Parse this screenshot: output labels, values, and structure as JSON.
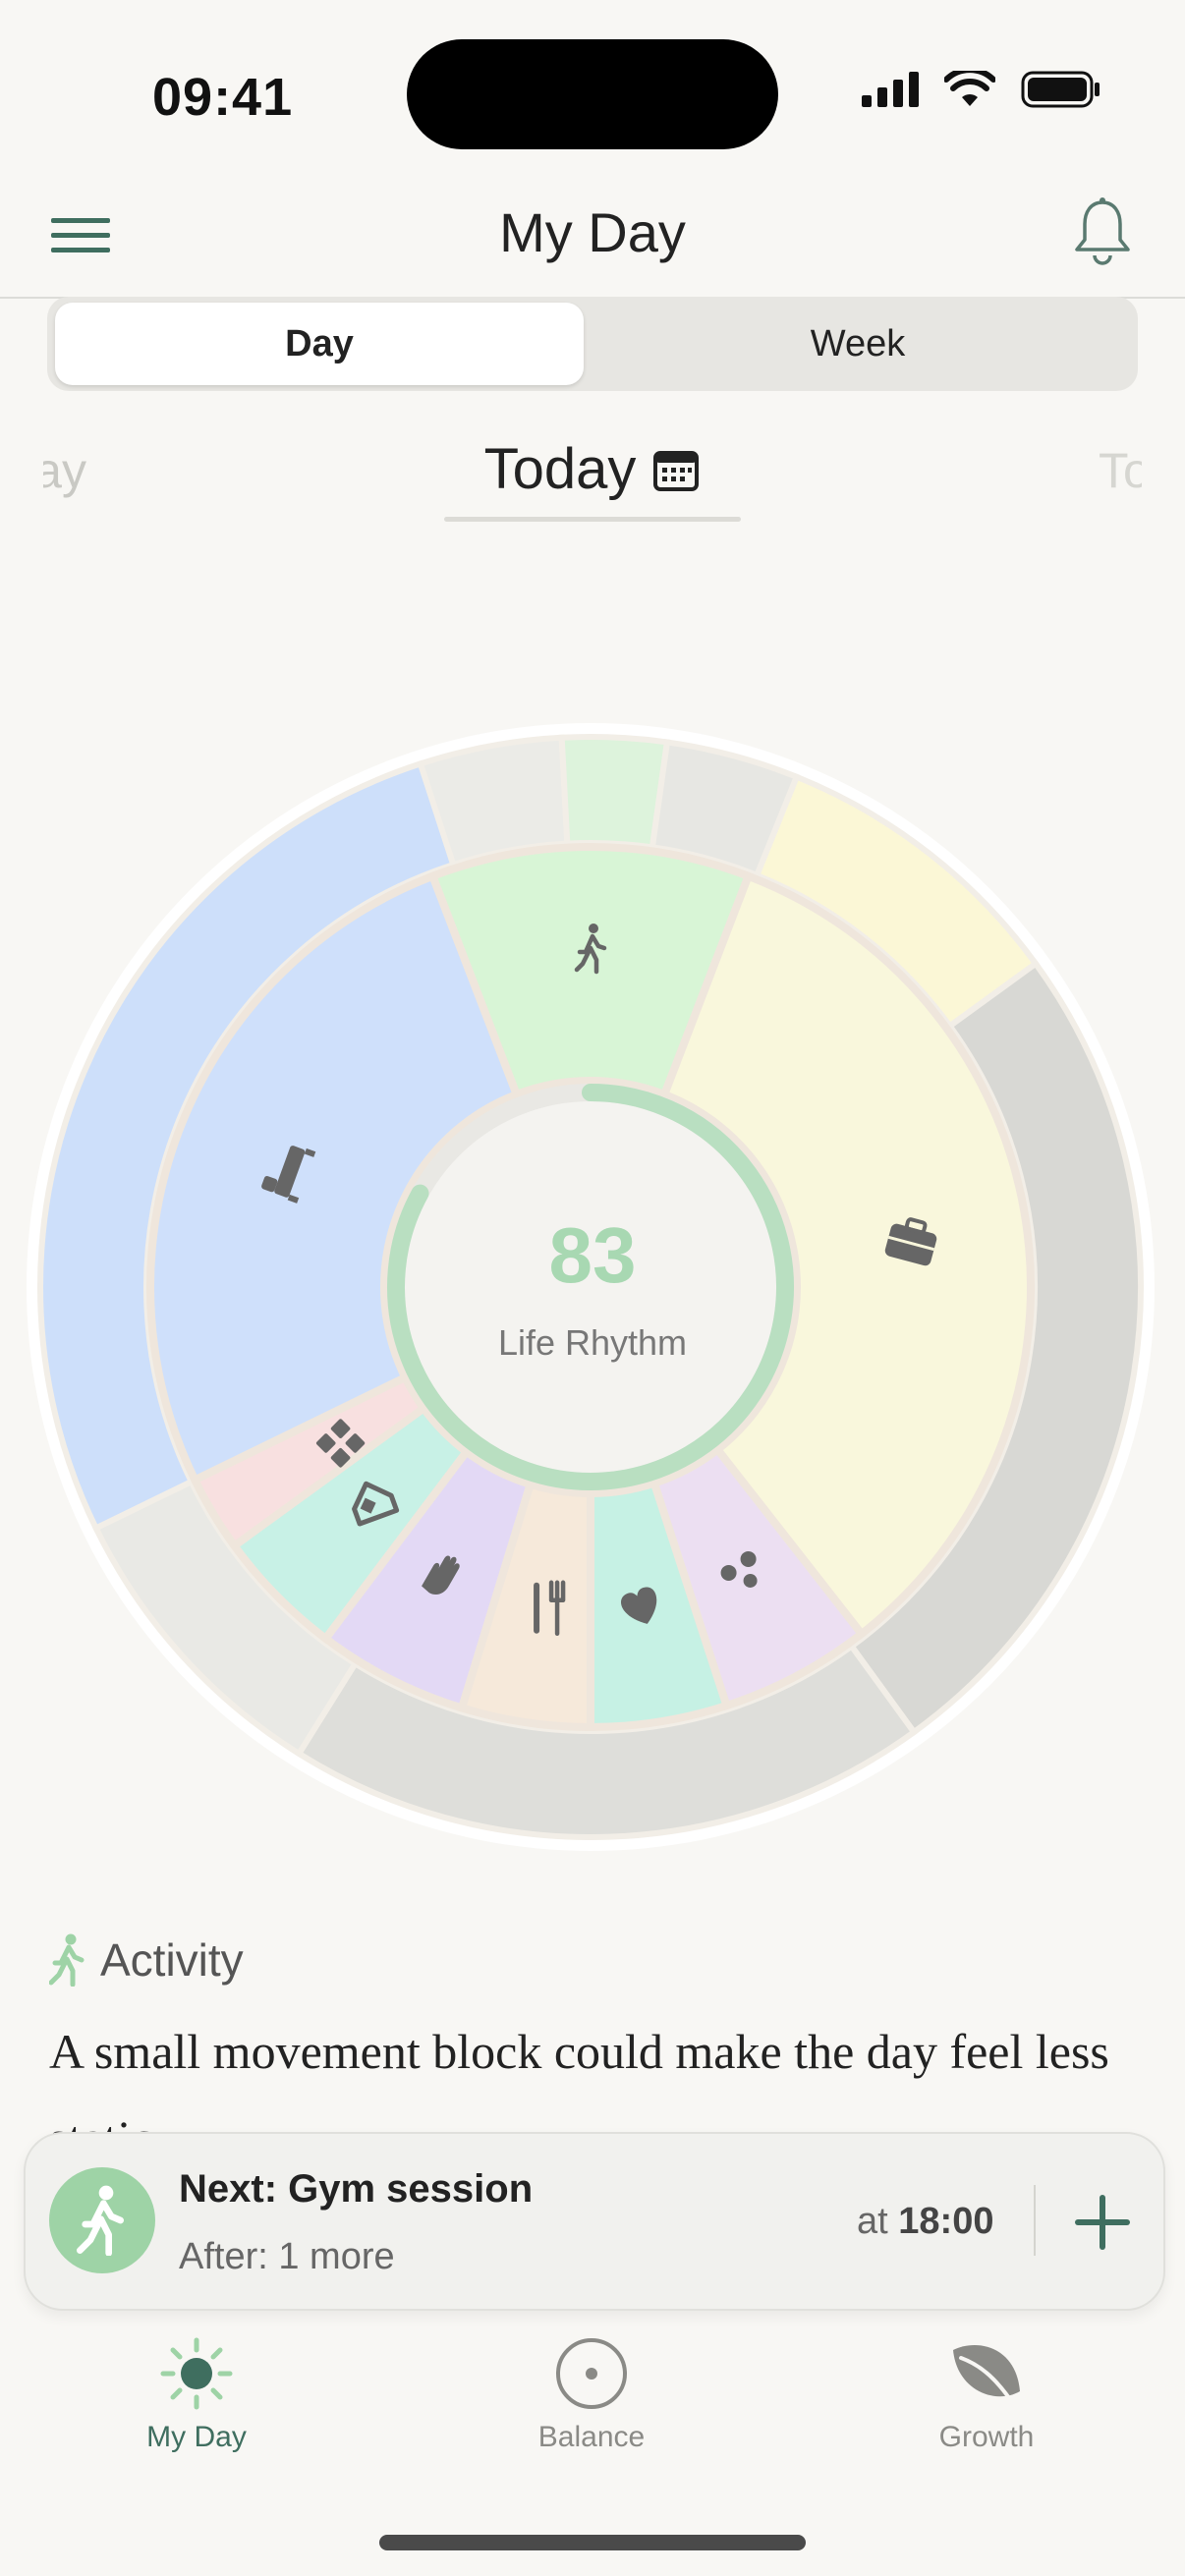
{
  "status_bar": {
    "time": "09:41"
  },
  "header": {
    "title": "My Day"
  },
  "segmented": {
    "day": "Day",
    "week": "Week"
  },
  "date_selector": {
    "prev": "Yesterday",
    "current": "Today",
    "next": "Tomorrow"
  },
  "wheel": {
    "score": "83",
    "score_label": "Life Rhythm",
    "score_progress": 0.83,
    "segments": [
      {
        "name": "sleep",
        "icon": "bed-icon",
        "color": "#cfe0fb"
      },
      {
        "name": "activity",
        "icon": "walking-icon",
        "color": "#d8f5d6"
      },
      {
        "name": "work",
        "icon": "briefcase-icon",
        "color": "#f9f7dc"
      },
      {
        "name": "social",
        "icon": "people-icon",
        "color": "#ecdff2"
      },
      {
        "name": "self-care",
        "icon": "heart-hand-icon",
        "color": "#c6f1e4"
      },
      {
        "name": "meals",
        "icon": "fork-knife-icon",
        "color": "#f6e9da"
      },
      {
        "name": "care",
        "icon": "hand-icon",
        "color": "#e3d9f5"
      },
      {
        "name": "home",
        "icon": "home-icon",
        "color": "#c8f1e6"
      },
      {
        "name": "other",
        "icon": "grid-icon",
        "color": "#f8e0e0"
      }
    ]
  },
  "insight": {
    "category": "Activity",
    "text": "A small movement block could make the day feel less static."
  },
  "next_card": {
    "title": "Next: Gym session",
    "subtitle": "After: 1 more",
    "time_prefix": "at",
    "time": "18:00"
  },
  "tabs": [
    {
      "label": "My Day",
      "icon": "sun-icon",
      "active": true
    },
    {
      "label": "Balance",
      "icon": "target-icon",
      "active": false
    },
    {
      "label": "Growth",
      "icon": "leaf-icon",
      "active": false
    }
  ],
  "colors": {
    "accent": "#3f6e5f",
    "score": "#a8d8b2",
    "ring": "#b9dfc1"
  }
}
